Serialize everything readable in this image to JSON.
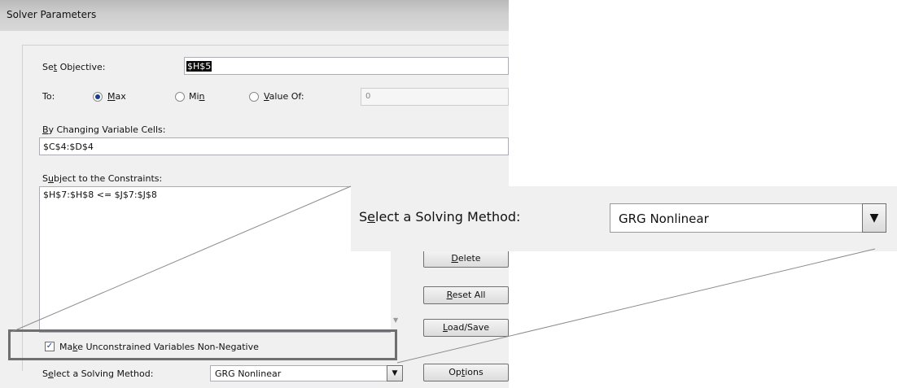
{
  "window": {
    "title": "Solver Parameters"
  },
  "objective": {
    "label_pre": "Se",
    "label_ul": "t",
    "label_post": " Objective:",
    "value": "$H$5"
  },
  "to": {
    "label": "To:",
    "max": {
      "label_ul": "M",
      "label_post": "ax",
      "selected": true
    },
    "min": {
      "label_pre": "Mi",
      "label_ul": "n",
      "selected": false
    },
    "value_of": {
      "label_ul": "V",
      "label_post": "alue Of:",
      "selected": false,
      "value": "0"
    }
  },
  "changing_cells": {
    "label_ul": "B",
    "label_post": "y Changing Variable Cells:",
    "value": "$C$4:$D$4"
  },
  "constraints": {
    "label_pre": "S",
    "label_ul": "u",
    "label_post": "bject to the Constraints:",
    "items": [
      "$H$7:$H$8 <= $J$7:$J$8"
    ]
  },
  "buttons": {
    "delete": {
      "label_ul": "D",
      "label_post": "elete"
    },
    "reset_all": {
      "label_ul": "R",
      "label_post": "eset All"
    },
    "load_save": {
      "label_ul": "L",
      "label_post": "oad/Save"
    },
    "options": {
      "label_pre": "Op",
      "label_ul": "t",
      "label_post": "ions"
    }
  },
  "nonnegative": {
    "label_pre": "Ma",
    "label_ul": "k",
    "label_post": "e Unconstrained Variables Non-Negative",
    "checked": true
  },
  "solving_method": {
    "label_pre": "S",
    "label_ul": "e",
    "label_post": "lect a Solving Method:",
    "value": "GRG Nonlinear"
  },
  "zoom_callout": {
    "label_pre": "S",
    "label_ul": "e",
    "label_post": "lect a Solving Method:",
    "value": "GRG Nonlinear"
  },
  "icons": {
    "dropdown": "triangle-down-icon",
    "check": "check-icon"
  }
}
